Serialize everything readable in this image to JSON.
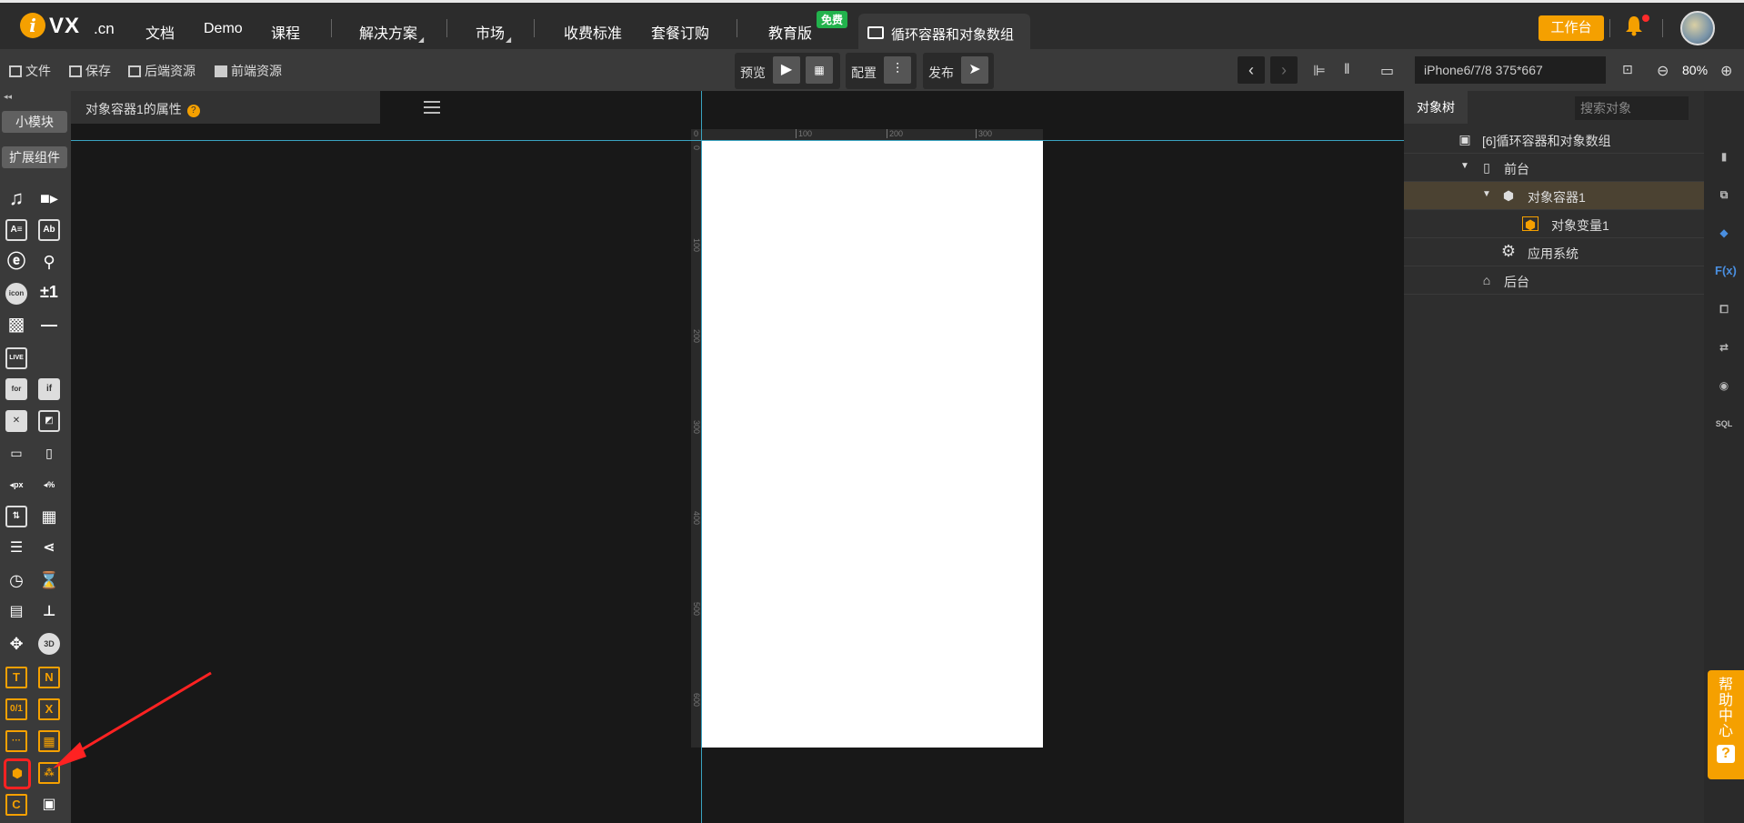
{
  "nav": {
    "logo_letter": "i",
    "logo_text": "VX",
    "logo_domain": ".cn",
    "items": [
      "文档",
      "Demo",
      "课程",
      "解决方案",
      "市场",
      "收费标准",
      "套餐订购",
      "教育版"
    ],
    "free_badge": "免费",
    "active_tab": "循环容器和对象数组",
    "workbench": "工作台"
  },
  "toolbar": {
    "file": "文件",
    "save": "保存",
    "backend_res": "后端资源",
    "frontend_res": "前端资源",
    "preview": "预览",
    "config": "配置",
    "publish": "发布",
    "device": "iPhone6/7/8 375*667",
    "zoom": "80%"
  },
  "left_panel": {
    "small_module": "小模块",
    "ext_components": "扩展组件"
  },
  "properties": {
    "title": "对象容器1的属性",
    "help": "?"
  },
  "ruler": {
    "top_ticks": [
      "0",
      "100",
      "200",
      "300"
    ],
    "left_ticks": [
      "0",
      "100",
      "200",
      "300",
      "400",
      "500",
      "600"
    ]
  },
  "object_tree": {
    "tab": "对象树",
    "search_placeholder": "搜索对象",
    "nodes": [
      {
        "label": "[6]循环容器和对象数组"
      },
      {
        "label": "前台"
      },
      {
        "label": "对象容器1"
      },
      {
        "label": "对象变量1"
      },
      {
        "label": "应用系统"
      },
      {
        "label": "后台"
      }
    ]
  },
  "help_center": {
    "label": "帮助中心",
    "q": "?"
  },
  "colors": {
    "accent": "#f5a000",
    "guide": "#3aa3c0",
    "highlight": "#ff2222"
  }
}
